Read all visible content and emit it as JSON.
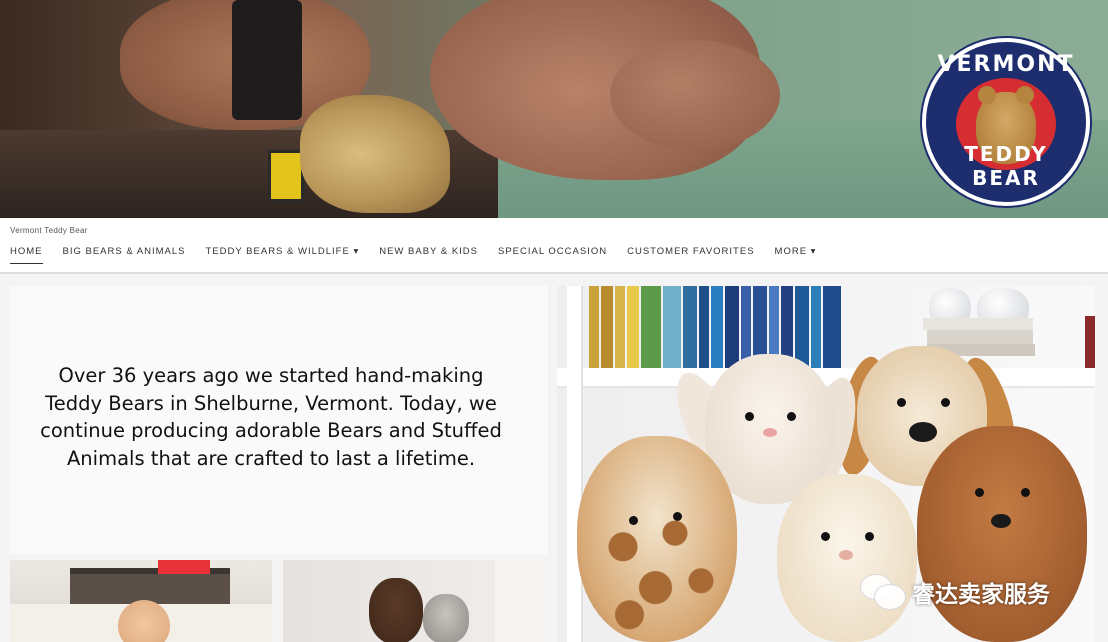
{
  "hero": {
    "logo_text_top": "VERMONT",
    "logo_text_bottom": "TEDDY BEAR",
    "logo_colors": {
      "ring": "#1d2d6e",
      "center": "#d62d32"
    }
  },
  "store": {
    "name": "Vermont Teddy Bear"
  },
  "nav": {
    "items": [
      {
        "label": "HOME",
        "active": true
      },
      {
        "label": "BIG BEARS & ANIMALS"
      },
      {
        "label": "TEDDY BEARS & WILDLIFE ▾"
      },
      {
        "label": "NEW BABY & KIDS"
      },
      {
        "label": "SPECIAL OCCASION"
      },
      {
        "label": "CUSTOMER FAVORITES"
      },
      {
        "label": "MORE ▾"
      }
    ]
  },
  "intro": {
    "text": "Over 36 years ago we started hand-making Teddy Bears in Shelburne, Vermont. Today, we continue producing adorable Bears and Stuffed Animals that are crafted to last a lifetime."
  },
  "watermark": {
    "icon": "wechat-icon",
    "text": "睿达卖家服务"
  }
}
